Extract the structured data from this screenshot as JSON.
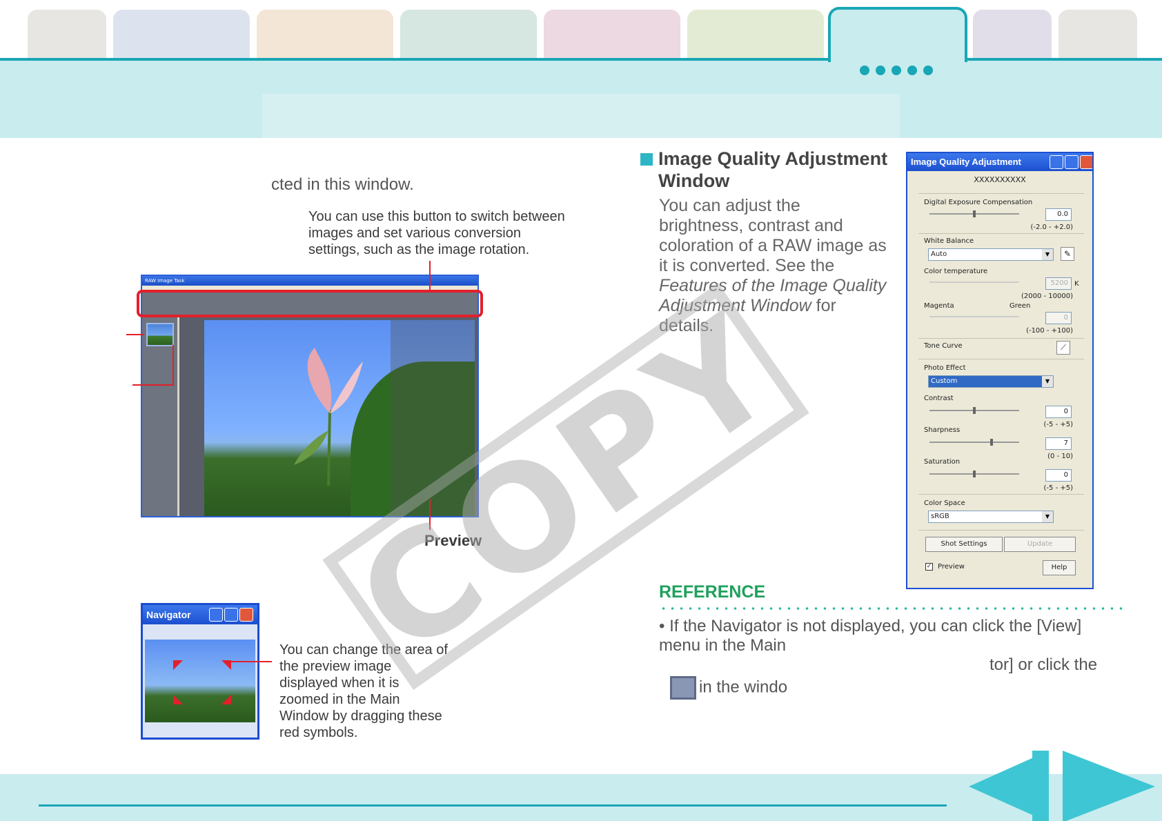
{
  "header": {
    "tab_colors": [
      "#e8e6e2",
      "#dde3ee",
      "#f3e6d6",
      "#d6e6e0",
      "#ecd9e2",
      "#e3ebd4",
      "#c9ecef",
      "#e2dee9",
      "#e8e6e2"
    ]
  },
  "left": {
    "intro_fragment": "cted in this window.",
    "toolbar_callout": "You can use this button to switch between images and set various conversion settings, such as the image rotation.",
    "preview_label": "Preview",
    "raw_window_title": "RAW Image Task",
    "navigator_title": "Navigator",
    "navigator_callout": "You can change the area of the preview image displayed when it is zoomed in the Main Window by dragging these red symbols."
  },
  "right": {
    "heading": "Image Quality Adjustment Window",
    "desc_1": "You can adjust the brightness, contrast and coloration of a RAW image as it is converted. See the ",
    "desc_italic": "Features of the Image Quality Adjustment Window",
    "desc_2": " for details.",
    "reference_title": "REFERENCE",
    "reference_text_1": "If the Navigator is not displayed, you can click the [View] menu in the Main",
    "reference_text_2": "tor] or click the",
    "reference_text_3": "in the windo"
  },
  "iqa": {
    "title": "Image Quality Adjustment",
    "filename": "XXXXXXXXXX",
    "digital_exposure_label": "Digital Exposure Compensation",
    "digital_exposure_value": "0.0",
    "digital_exposure_range": "(-2.0 - +2.0)",
    "white_balance_label": "White Balance",
    "white_balance_value": "Auto",
    "color_temp_label": "Color temperature",
    "color_temp_value": "5200",
    "color_temp_unit": "K",
    "color_temp_range": "(2000 - 10000)",
    "magenta_label": "Magenta",
    "green_label": "Green",
    "magenta_value": "0",
    "magenta_range": "(-100 - +100)",
    "tone_curve_label": "Tone Curve",
    "photo_effect_label": "Photo Effect",
    "photo_effect_value": "Custom",
    "contrast_label": "Contrast",
    "contrast_value": "0",
    "contrast_range": "(-5 - +5)",
    "sharpness_label": "Sharpness",
    "sharpness_value": "7",
    "sharpness_range": "(0 - 10)",
    "saturation_label": "Saturation",
    "saturation_value": "0",
    "saturation_range": "(-5 - +5)",
    "color_space_label": "Color Space",
    "color_space_value": "sRGB",
    "shot_settings_label": "Shot Settings",
    "update_label": "Update",
    "preview_label": "Preview",
    "help_label": "Help"
  },
  "watermark": "COPY"
}
